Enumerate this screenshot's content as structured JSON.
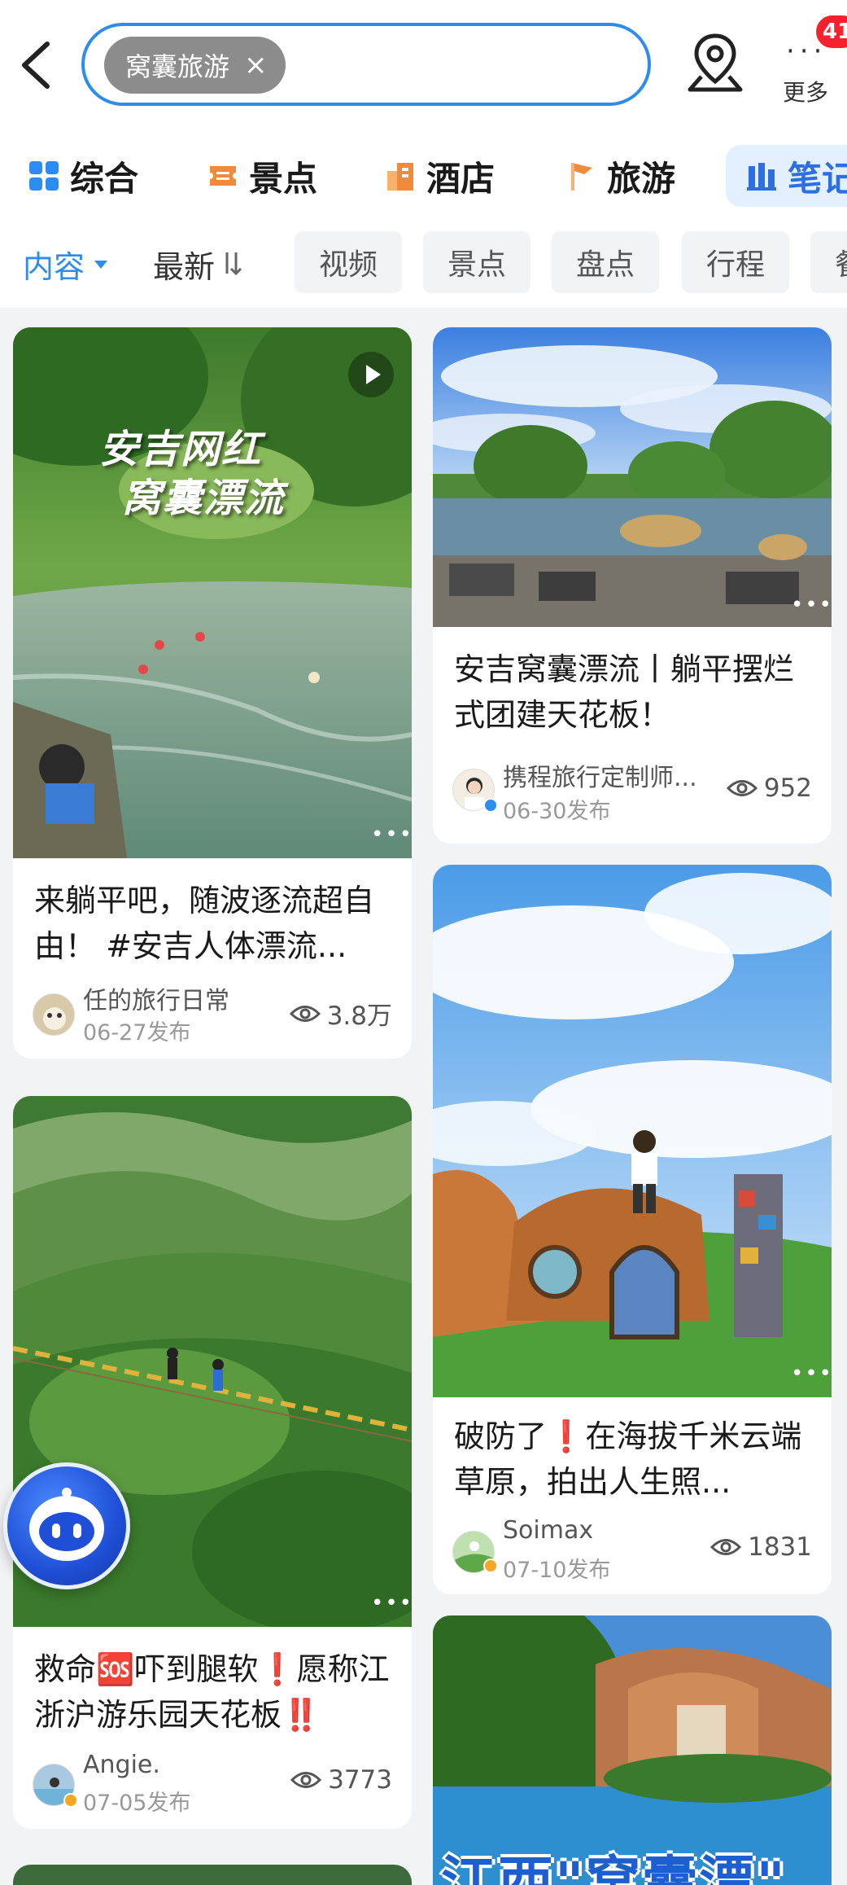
{
  "search": {
    "query_tag": "窝囊旅游",
    "clear_symbol": "×"
  },
  "header": {
    "more_label": "更多",
    "badge_count": "41"
  },
  "categories": [
    {
      "label": "综合"
    },
    {
      "label": "景点"
    },
    {
      "label": "酒店"
    },
    {
      "label": "旅游"
    },
    {
      "label": "笔记",
      "active": true
    }
  ],
  "filters": {
    "content_sort": "内容",
    "latest_sort": "最新",
    "chips": [
      "视频",
      "景点",
      "盘点",
      "行程",
      "餐"
    ]
  },
  "cards": [
    {
      "title": "来躺平吧，随波逐流超自由！ #安吉人体漂流...",
      "image_text_line1": "安吉网红",
      "image_text_line2": "窝囊漂流",
      "author": "任的旅行日常",
      "date": "06-27发布",
      "views": "3.8万",
      "is_video": true
    },
    {
      "title": "安吉窝囊漂流丨躺平摆烂式团建天花板！",
      "author": "携程旅行定制师...",
      "date": "06-30发布",
      "views": "952"
    },
    {
      "title": "救命🆘吓到腿软❗️愿称江浙沪游乐园天花板‼️",
      "author": "Angie.",
      "date": "07-05发布",
      "views": "3773"
    },
    {
      "title": "破防了❗️在海拔千米云端草原，拍出人生照...",
      "author": "Soimax",
      "date": "07-10发布",
      "views": "1831"
    },
    {
      "image_text": "江西\"窝囊漂\""
    }
  ],
  "icons": {
    "back": "chevron-left-icon",
    "location": "location-pin-icon",
    "more": "more-dots-icon",
    "views": "eye-icon",
    "play": "play-icon",
    "bot": "assistant-bot-icon"
  },
  "colors": {
    "accent": "#2d8cf0",
    "tab_active": "#2d6fe0",
    "badge": "#f5222d"
  }
}
